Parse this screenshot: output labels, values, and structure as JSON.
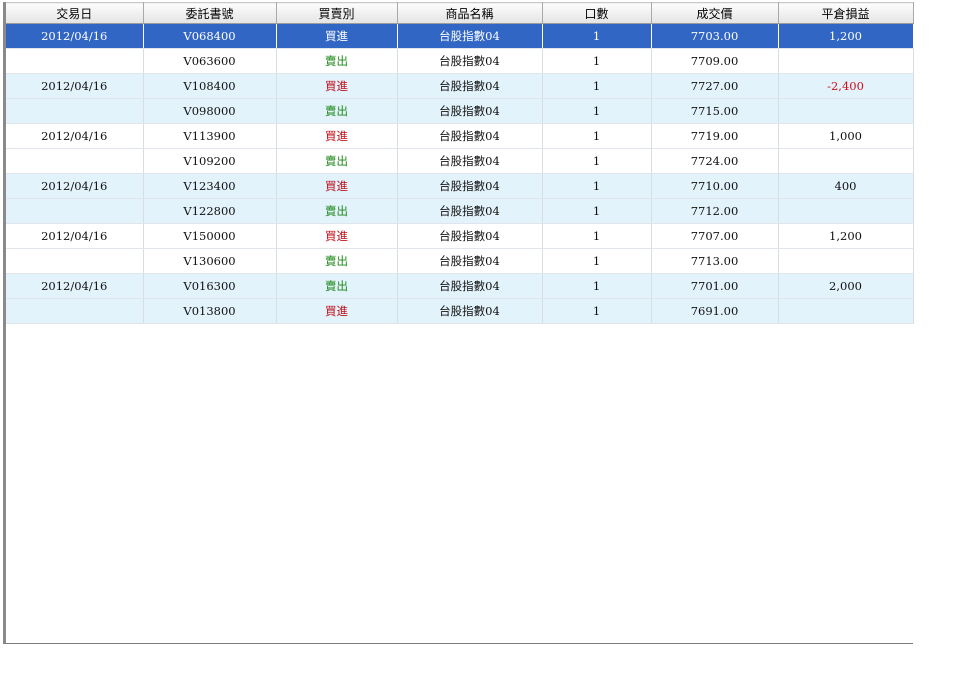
{
  "columns": [
    "交易日",
    "委託書號",
    "買賣別",
    "商品名稱",
    "口數",
    "成交價",
    "平倉損益"
  ],
  "rows": [
    {
      "date": "2012/04/16",
      "order_no": "V068400",
      "side": "買進",
      "side_type": "buy",
      "product": "台股指數04",
      "lots": "1",
      "price": "7703.00",
      "pnl": "1,200",
      "pnl_type": "pos",
      "band": "blue",
      "selected": true
    },
    {
      "date": "",
      "order_no": "V063600",
      "side": "賣出",
      "side_type": "sell",
      "product": "台股指數04",
      "lots": "1",
      "price": "7709.00",
      "pnl": "",
      "pnl_type": "pos",
      "band": "white",
      "selected": false
    },
    {
      "date": "2012/04/16",
      "order_no": "V108400",
      "side": "買進",
      "side_type": "buy",
      "product": "台股指數04",
      "lots": "1",
      "price": "7727.00",
      "pnl": "-2,400",
      "pnl_type": "neg",
      "band": "blue",
      "selected": false
    },
    {
      "date": "",
      "order_no": "V098000",
      "side": "賣出",
      "side_type": "sell",
      "product": "台股指數04",
      "lots": "1",
      "price": "7715.00",
      "pnl": "",
      "pnl_type": "pos",
      "band": "blue",
      "selected": false
    },
    {
      "date": "2012/04/16",
      "order_no": "V113900",
      "side": "買進",
      "side_type": "buy",
      "product": "台股指數04",
      "lots": "1",
      "price": "7719.00",
      "pnl": "1,000",
      "pnl_type": "pos",
      "band": "white",
      "selected": false
    },
    {
      "date": "",
      "order_no": "V109200",
      "side": "賣出",
      "side_type": "sell",
      "product": "台股指數04",
      "lots": "1",
      "price": "7724.00",
      "pnl": "",
      "pnl_type": "pos",
      "band": "white",
      "selected": false
    },
    {
      "date": "2012/04/16",
      "order_no": "V123400",
      "side": "買進",
      "side_type": "buy",
      "product": "台股指數04",
      "lots": "1",
      "price": "7710.00",
      "pnl": "400",
      "pnl_type": "pos",
      "band": "blue",
      "selected": false
    },
    {
      "date": "",
      "order_no": "V122800",
      "side": "賣出",
      "side_type": "sell",
      "product": "台股指數04",
      "lots": "1",
      "price": "7712.00",
      "pnl": "",
      "pnl_type": "pos",
      "band": "blue",
      "selected": false
    },
    {
      "date": "2012/04/16",
      "order_no": "V150000",
      "side": "買進",
      "side_type": "buy",
      "product": "台股指數04",
      "lots": "1",
      "price": "7707.00",
      "pnl": "1,200",
      "pnl_type": "pos",
      "band": "white",
      "selected": false
    },
    {
      "date": "",
      "order_no": "V130600",
      "side": "賣出",
      "side_type": "sell",
      "product": "台股指數04",
      "lots": "1",
      "price": "7713.00",
      "pnl": "",
      "pnl_type": "pos",
      "band": "white",
      "selected": false
    },
    {
      "date": "2012/04/16",
      "order_no": "V016300",
      "side": "賣出",
      "side_type": "sell",
      "product": "台股指數04",
      "lots": "1",
      "price": "7701.00",
      "pnl": "2,000",
      "pnl_type": "pos",
      "band": "blue",
      "selected": false
    },
    {
      "date": "",
      "order_no": "V013800",
      "side": "買進",
      "side_type": "buy",
      "product": "台股指數04",
      "lots": "1",
      "price": "7691.00",
      "pnl": "",
      "pnl_type": "pos",
      "band": "blue",
      "selected": false
    }
  ],
  "colors": {
    "selected": "#3166c5",
    "band_blue": "#e3f3fc",
    "buy": "#c0101a",
    "sell": "#1e8a1a",
    "negative": "#d0101a"
  }
}
